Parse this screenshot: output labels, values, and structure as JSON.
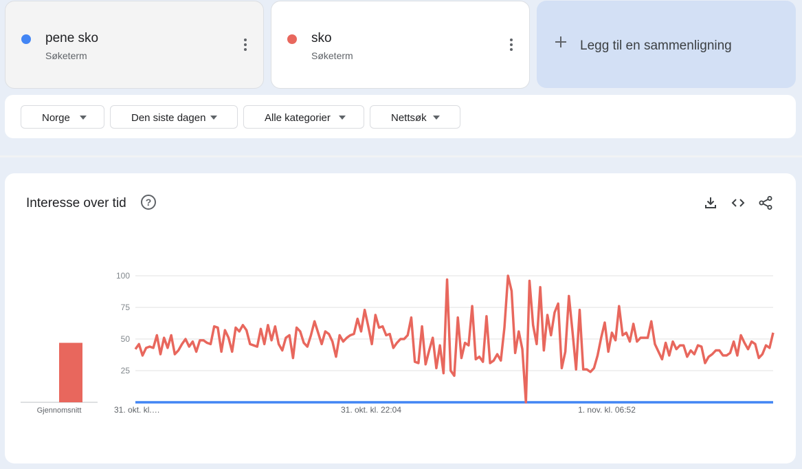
{
  "terms": [
    {
      "name": "pene sko",
      "subtitle": "Søketerm",
      "color": "#4285f4"
    },
    {
      "name": "sko",
      "subtitle": "Søketerm",
      "color": "#e8675d"
    }
  ],
  "add_comparison": {
    "label": "Legg til en sammenligning"
  },
  "filters": [
    {
      "label": "Norge"
    },
    {
      "label": "Den siste dagen"
    },
    {
      "label": "Alle kategorier"
    },
    {
      "label": "Nettsøk"
    }
  ],
  "section": {
    "title": "Interesse over tid",
    "help_icon": "question-circle-icon",
    "actions": [
      "download-icon",
      "embed-code-icon",
      "share-icon"
    ]
  },
  "chart_data": {
    "type": "line",
    "ylim": [
      0,
      100
    ],
    "yticks": [
      25,
      50,
      75,
      100
    ],
    "xtick_labels": [
      "31. okt. kl.…",
      "31. okt. kl. 22:04",
      "1. nov. kl. 06:52"
    ],
    "average": {
      "label": "Gjennomsnitt",
      "values": [
        0,
        47
      ]
    },
    "series": [
      {
        "name": "pene sko",
        "color": "#4285f4",
        "values": [
          0
        ]
      },
      {
        "name": "sko",
        "color": "#e8675d",
        "values": [
          42,
          46,
          37,
          43,
          44,
          43,
          53,
          38,
          51,
          43,
          53,
          38,
          41,
          46,
          50,
          44,
          48,
          40,
          49,
          49,
          47,
          46,
          60,
          59,
          40,
          57,
          51,
          40,
          59,
          56,
          61,
          57,
          46,
          45,
          44,
          58,
          46,
          61,
          49,
          60,
          46,
          41,
          51,
          53,
          35,
          59,
          56,
          47,
          44,
          53,
          64,
          55,
          46,
          56,
          54,
          48,
          36,
          53,
          48,
          51,
          53,
          54,
          66,
          56,
          73,
          60,
          46,
          69,
          59,
          60,
          53,
          54,
          43,
          47,
          50,
          50,
          53,
          67,
          32,
          31,
          60,
          30,
          41,
          51,
          27,
          45,
          23,
          97,
          25,
          21,
          67,
          35,
          47,
          45,
          76,
          34,
          36,
          32,
          68,
          31,
          33,
          38,
          33,
          59,
          100,
          88,
          39,
          56,
          42,
          0,
          96,
          61,
          46,
          91,
          41,
          69,
          53,
          71,
          78,
          27,
          40,
          84,
          56,
          26,
          73,
          26,
          26,
          24,
          27,
          37,
          51,
          63,
          40,
          55,
          49,
          76,
          53,
          55,
          48,
          62,
          48,
          51,
          51,
          51,
          64,
          46,
          40,
          34,
          47,
          37,
          48,
          42,
          45,
          45,
          36,
          41,
          38,
          45,
          44,
          31,
          36,
          38,
          41,
          41,
          37,
          37,
          39,
          48,
          37,
          53,
          47,
          42,
          48,
          46,
          35,
          38,
          45,
          43,
          55
        ]
      }
    ]
  }
}
